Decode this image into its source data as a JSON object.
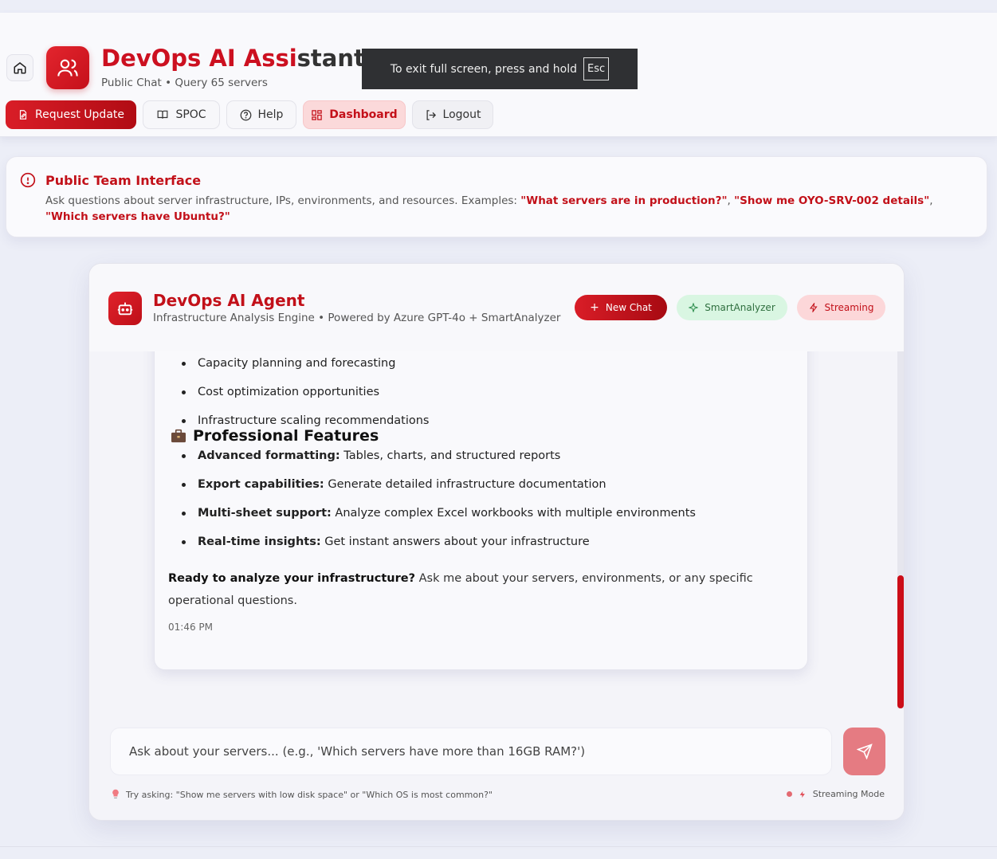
{
  "header": {
    "title_main": "DevOps AI Assi",
    "title_tail": "stant",
    "subtitle": "Public Chat • Query 65 servers",
    "fullscreen_notice": "To exit full screen, press and hold",
    "fullscreen_key": "Esc"
  },
  "nav": {
    "request_update": "Request Update",
    "spoc": "SPOC",
    "help": "Help",
    "dashboard": "Dashboard",
    "logout": "Logout"
  },
  "banner": {
    "title": "Public Team Interface",
    "text": "Ask questions about server infrastructure, IPs, environments, and resources. Examples: ",
    "ex1": "\"What servers are in production?\"",
    "ex2": "\"Show me OYO-SRV-002 details\"",
    "ex3": "\"Which servers have Ubuntu?\"",
    "sep": ", "
  },
  "agent": {
    "title": "DevOps AI Agent",
    "subtitle": "Infrastructure Analysis Engine • Powered by Azure GPT-4o + SmartAnalyzer",
    "new_chat": "New Chat",
    "smart": "SmartAnalyzer",
    "streaming": "Streaming"
  },
  "message": {
    "list1": [
      "Capacity planning and forecasting",
      "Cost optimization opportunities",
      "Infrastructure scaling recommendations"
    ],
    "section_title": "Professional Features",
    "features": [
      {
        "label": "Advanced formatting:",
        "text": " Tables, charts, and structured reports"
      },
      {
        "label": "Export capabilities:",
        "text": " Generate detailed infrastructure documentation"
      },
      {
        "label": "Multi-sheet support:",
        "text": " Analyze complex Excel workbooks with multiple environments"
      },
      {
        "label": "Real-time insights:",
        "text": " Get instant answers about your infrastructure"
      }
    ],
    "ready_bold": "Ready to analyze your infrastructure?",
    "ready_text": " Ask me about your servers, environments, or any specific operational questions.",
    "time": "01:46 PM"
  },
  "input": {
    "placeholder": "Ask about your servers... (e.g., 'Which servers have more than 16GB RAM?')"
  },
  "hints": {
    "try": "Try asking: \"Show me servers with low disk space\" or \"Which OS is most common?\"",
    "mode": "Streaming Mode"
  },
  "colors": {
    "brand": "#cc1020",
    "accent_soft": "#fbd9da",
    "green_soft": "#d9f6e2"
  }
}
